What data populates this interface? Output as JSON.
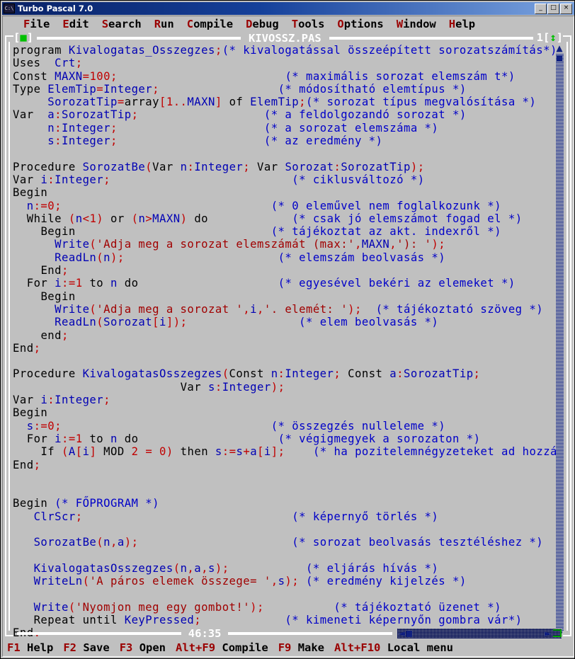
{
  "window": {
    "title": "Turbo Pascal 7.0",
    "icon": "dos-prompt-icon",
    "buttons": {
      "minimize": "_",
      "maximize": "□",
      "close": "×"
    }
  },
  "menubar": {
    "items": [
      {
        "hotkey": "F",
        "rest": "ile"
      },
      {
        "hotkey": "E",
        "rest": "dit"
      },
      {
        "hotkey": "S",
        "rest": "earch"
      },
      {
        "hotkey": "R",
        "rest": "un"
      },
      {
        "hotkey": "C",
        "rest": "ompile"
      },
      {
        "hotkey": "D",
        "rest": "ebug"
      },
      {
        "hotkey": "T",
        "rest": "ools"
      },
      {
        "hotkey": "O",
        "rest": "ptions"
      },
      {
        "hotkey": "W",
        "rest": "indow"
      },
      {
        "hotkey": "H",
        "rest": "elp"
      }
    ]
  },
  "editor": {
    "file_title": "KIVOSSZ.PAS",
    "window_number": "1",
    "close_box": "[■]",
    "zoom_box": "[↕]",
    "cursor_position": "46:35",
    "scrollbar": {
      "up_arrow": "▲",
      "down_arrow": "▼",
      "left_arrow": "◄",
      "right_arrow": "►"
    },
    "lines": [
      [
        [
          "kw",
          "program "
        ],
        [
          "id",
          "Kivalogatas_Osszegzes"
        ],
        [
          "pn",
          ";"
        ],
        [
          "cm",
          "(* kivalogatással összeépített sorozatszámítás*)"
        ]
      ],
      [
        [
          "kw",
          "Uses  "
        ],
        [
          "id",
          "Crt"
        ],
        [
          "pn",
          ";"
        ]
      ],
      [
        [
          "kw",
          "Const "
        ],
        [
          "id",
          "MAXN"
        ],
        [
          "pn",
          "="
        ],
        [
          "num",
          "100"
        ],
        [
          "pn",
          ";"
        ],
        [
          "sp",
          "                        "
        ],
        [
          "cm",
          "(* maximális sorozat elemszám t*)"
        ]
      ],
      [
        [
          "kw",
          "Type "
        ],
        [
          "id",
          "ElemTip"
        ],
        [
          "pn",
          "="
        ],
        [
          "id",
          "Integer"
        ],
        [
          "pn",
          ";"
        ],
        [
          "sp",
          "                 "
        ],
        [
          "cm",
          "(* módosítható elemtípus *)"
        ]
      ],
      [
        [
          "sp",
          "     "
        ],
        [
          "id",
          "SorozatTip"
        ],
        [
          "pn",
          "="
        ],
        [
          "kw",
          "array"
        ],
        [
          "pn",
          "["
        ],
        [
          "num",
          "1"
        ],
        [
          "pn",
          ".."
        ],
        [
          "id",
          "MAXN"
        ],
        [
          "pn",
          "]"
        ],
        [
          "kw",
          " of "
        ],
        [
          "id",
          "ElemTip"
        ],
        [
          "pn",
          ";"
        ],
        [
          "cm",
          "(* sorozat típus megvalósítása *)"
        ]
      ],
      [
        [
          "kw",
          "Var  "
        ],
        [
          "id",
          "a"
        ],
        [
          "pn",
          ":"
        ],
        [
          "id",
          "SorozatTip"
        ],
        [
          "pn",
          ";"
        ],
        [
          "sp",
          "                  "
        ],
        [
          "cm",
          "(* a feldolgozandó sorozat *)"
        ]
      ],
      [
        [
          "sp",
          "     "
        ],
        [
          "id",
          "n"
        ],
        [
          "pn",
          ":"
        ],
        [
          "id",
          "Integer"
        ],
        [
          "pn",
          ";"
        ],
        [
          "sp",
          "                     "
        ],
        [
          "cm",
          "(* a sorozat elemszáma *)"
        ]
      ],
      [
        [
          "sp",
          "     "
        ],
        [
          "id",
          "s"
        ],
        [
          "pn",
          ":"
        ],
        [
          "id",
          "Integer"
        ],
        [
          "pn",
          ";"
        ],
        [
          "sp",
          "                     "
        ],
        [
          "cm",
          "(* az eredmény *)"
        ]
      ],
      [],
      [
        [
          "kw",
          "Procedure "
        ],
        [
          "id",
          "SorozatBe"
        ],
        [
          "pn",
          "("
        ],
        [
          "kw",
          "Var "
        ],
        [
          "id",
          "n"
        ],
        [
          "pn",
          ":"
        ],
        [
          "id",
          "Integer"
        ],
        [
          "pn",
          "; "
        ],
        [
          "kw",
          "Var "
        ],
        [
          "id",
          "Sorozat"
        ],
        [
          "pn",
          ":"
        ],
        [
          "id",
          "SorozatTip"
        ],
        [
          "pn",
          ");"
        ]
      ],
      [
        [
          "kw",
          "Var "
        ],
        [
          "id",
          "i"
        ],
        [
          "pn",
          ":"
        ],
        [
          "id",
          "Integer"
        ],
        [
          "pn",
          ";"
        ],
        [
          "sp",
          "                          "
        ],
        [
          "cm",
          "(* ciklusváltozó *)"
        ]
      ],
      [
        [
          "kw",
          "Begin"
        ]
      ],
      [
        [
          "sp",
          "  "
        ],
        [
          "id",
          "n"
        ],
        [
          "pn",
          ":="
        ],
        [
          "num",
          "0"
        ],
        [
          "pn",
          ";"
        ],
        [
          "sp",
          "                              "
        ],
        [
          "cm",
          "(* 0 eleművel nem foglalkozunk *)"
        ]
      ],
      [
        [
          "sp",
          "  "
        ],
        [
          "kw",
          "While "
        ],
        [
          "pn",
          "("
        ],
        [
          "id",
          "n"
        ],
        [
          "pn",
          "<"
        ],
        [
          "num",
          "1"
        ],
        [
          "pn",
          ") "
        ],
        [
          "kw",
          "or "
        ],
        [
          "pn",
          "("
        ],
        [
          "id",
          "n"
        ],
        [
          "pn",
          ">"
        ],
        [
          "id",
          "MAXN"
        ],
        [
          "pn",
          ") "
        ],
        [
          "kw",
          "do"
        ],
        [
          "sp",
          "            "
        ],
        [
          "cm",
          "(* csak jó elemszámot fogad el *)"
        ]
      ],
      [
        [
          "sp",
          "    "
        ],
        [
          "kw",
          "Begin"
        ],
        [
          "sp",
          "                            "
        ],
        [
          "cm",
          "(* tájékoztat az akt. indexről *)"
        ]
      ],
      [
        [
          "sp",
          "      "
        ],
        [
          "id",
          "Write"
        ],
        [
          "pn",
          "("
        ],
        [
          "st",
          "'Adja meg a sorozat elemszámát (max:'"
        ],
        [
          "pn",
          ","
        ],
        [
          "id",
          "MAXN"
        ],
        [
          "pn",
          ","
        ],
        [
          "st",
          "'): '"
        ],
        [
          "pn",
          ");"
        ]
      ],
      [
        [
          "sp",
          "      "
        ],
        [
          "id",
          "ReadLn"
        ],
        [
          "pn",
          "("
        ],
        [
          "id",
          "n"
        ],
        [
          "pn",
          ");"
        ],
        [
          "sp",
          "                      "
        ],
        [
          "cm",
          "(* elemszám beolvasás *)"
        ]
      ],
      [
        [
          "sp",
          "    "
        ],
        [
          "kw",
          "End"
        ],
        [
          "pn",
          ";"
        ]
      ],
      [
        [
          "sp",
          "  "
        ],
        [
          "kw",
          "For "
        ],
        [
          "id",
          "i"
        ],
        [
          "pn",
          ":="
        ],
        [
          "num",
          "1"
        ],
        [
          "kw",
          " to "
        ],
        [
          "id",
          "n"
        ],
        [
          "kw",
          " do"
        ],
        [
          "sp",
          "                    "
        ],
        [
          "cm",
          "(* egyesével bekéri az elemeket *)"
        ]
      ],
      [
        [
          "sp",
          "    "
        ],
        [
          "kw",
          "Begin"
        ]
      ],
      [
        [
          "sp",
          "      "
        ],
        [
          "id",
          "Write"
        ],
        [
          "pn",
          "("
        ],
        [
          "st",
          "'Adja meg a sorozat '"
        ],
        [
          "pn",
          ","
        ],
        [
          "id",
          "i"
        ],
        [
          "pn",
          ","
        ],
        [
          "st",
          "'. elemét: '"
        ],
        [
          "pn",
          ");"
        ],
        [
          "sp",
          "  "
        ],
        [
          "cm",
          "(* tájékoztató szöveg *)"
        ]
      ],
      [
        [
          "sp",
          "      "
        ],
        [
          "id",
          "ReadLn"
        ],
        [
          "pn",
          "("
        ],
        [
          "id",
          "Sorozat"
        ],
        [
          "pn",
          "["
        ],
        [
          "id",
          "i"
        ],
        [
          "pn",
          "]);"
        ],
        [
          "sp",
          "                "
        ],
        [
          "cm",
          "(* elem beolvasás *)"
        ]
      ],
      [
        [
          "sp",
          "    "
        ],
        [
          "kw",
          "end"
        ],
        [
          "pn",
          ";"
        ]
      ],
      [
        [
          "kw",
          "End"
        ],
        [
          "pn",
          ";"
        ]
      ],
      [],
      [
        [
          "kw",
          "Procedure "
        ],
        [
          "id",
          "KivalogatasOsszegzes"
        ],
        [
          "pn",
          "("
        ],
        [
          "kw",
          "Const "
        ],
        [
          "id",
          "n"
        ],
        [
          "pn",
          ":"
        ],
        [
          "id",
          "Integer"
        ],
        [
          "pn",
          "; "
        ],
        [
          "kw",
          "Const "
        ],
        [
          "id",
          "a"
        ],
        [
          "pn",
          ":"
        ],
        [
          "id",
          "SorozatTip"
        ],
        [
          "pn",
          ";"
        ]
      ],
      [
        [
          "sp",
          "                        "
        ],
        [
          "kw",
          "Var "
        ],
        [
          "id",
          "s"
        ],
        [
          "pn",
          ":"
        ],
        [
          "id",
          "Integer"
        ],
        [
          "pn",
          ");"
        ]
      ],
      [
        [
          "kw",
          "Var "
        ],
        [
          "id",
          "i"
        ],
        [
          "pn",
          ":"
        ],
        [
          "id",
          "Integer"
        ],
        [
          "pn",
          ";"
        ]
      ],
      [
        [
          "kw",
          "Begin"
        ]
      ],
      [
        [
          "sp",
          "  "
        ],
        [
          "id",
          "s"
        ],
        [
          "pn",
          ":="
        ],
        [
          "num",
          "0"
        ],
        [
          "pn",
          ";"
        ],
        [
          "sp",
          "                              "
        ],
        [
          "cm",
          "(* összegzés nulleleme *)"
        ]
      ],
      [
        [
          "sp",
          "  "
        ],
        [
          "kw",
          "For "
        ],
        [
          "id",
          "i"
        ],
        [
          "pn",
          ":="
        ],
        [
          "num",
          "1"
        ],
        [
          "kw",
          " to "
        ],
        [
          "id",
          "n"
        ],
        [
          "kw",
          " do"
        ],
        [
          "sp",
          "                    "
        ],
        [
          "cm",
          "(* végigmegyek a sorozaton *)"
        ]
      ],
      [
        [
          "sp",
          "    "
        ],
        [
          "kw",
          "If "
        ],
        [
          "pn",
          "("
        ],
        [
          "id",
          "A"
        ],
        [
          "pn",
          "["
        ],
        [
          "id",
          "i"
        ],
        [
          "pn",
          "] "
        ],
        [
          "kw",
          "MOD "
        ],
        [
          "num",
          "2"
        ],
        [
          "pn",
          " = "
        ],
        [
          "num",
          "0"
        ],
        [
          "pn",
          ") "
        ],
        [
          "kw",
          "then "
        ],
        [
          "id",
          "s"
        ],
        [
          "pn",
          ":="
        ],
        [
          "id",
          "s"
        ],
        [
          "pn",
          "+"
        ],
        [
          "id",
          "a"
        ],
        [
          "pn",
          "["
        ],
        [
          "id",
          "i"
        ],
        [
          "pn",
          "];"
        ],
        [
          "sp",
          "    "
        ],
        [
          "cm",
          "(* ha pozitelemnégyzeteket ad hozzá"
        ]
      ],
      [
        [
          "kw",
          "End"
        ],
        [
          "pn",
          ";"
        ]
      ],
      [],
      [],
      [
        [
          "kw",
          "Begin "
        ],
        [
          "cm",
          "(* FŐPROGRAM *)"
        ]
      ],
      [
        [
          "sp",
          "   "
        ],
        [
          "id",
          "ClrScr"
        ],
        [
          "pn",
          ";"
        ],
        [
          "sp",
          "                              "
        ],
        [
          "cm",
          "(* képernyő törlés *)"
        ]
      ],
      [],
      [
        [
          "sp",
          "   "
        ],
        [
          "id",
          "SorozatBe"
        ],
        [
          "pn",
          "("
        ],
        [
          "id",
          "n"
        ],
        [
          "pn",
          ","
        ],
        [
          "id",
          "a"
        ],
        [
          "pn",
          ");"
        ],
        [
          "sp",
          "                      "
        ],
        [
          "cm",
          "(* sorozat beolvasás tesztéléshez *)"
        ]
      ],
      [],
      [
        [
          "sp",
          "   "
        ],
        [
          "id",
          "KivalogatasOsszegzes"
        ],
        [
          "pn",
          "("
        ],
        [
          "id",
          "n"
        ],
        [
          "pn",
          ","
        ],
        [
          "id",
          "a"
        ],
        [
          "pn",
          ","
        ],
        [
          "id",
          "s"
        ],
        [
          "pn",
          ");"
        ],
        [
          "sp",
          "           "
        ],
        [
          "cm",
          "(* eljárás hívás *)"
        ]
      ],
      [
        [
          "sp",
          "   "
        ],
        [
          "id",
          "WriteLn"
        ],
        [
          "pn",
          "("
        ],
        [
          "st",
          "'A páros elemek összege= '"
        ],
        [
          "pn",
          ","
        ],
        [
          "id",
          "s"
        ],
        [
          "pn",
          ");"
        ],
        [
          "sp",
          " "
        ],
        [
          "cm",
          "(* eredmény kijelzés *)"
        ]
      ],
      [],
      [
        [
          "sp",
          "   "
        ],
        [
          "id",
          "Write"
        ],
        [
          "pn",
          "("
        ],
        [
          "st",
          "'Nyomjon meg egy gombot!'"
        ],
        [
          "pn",
          ");"
        ],
        [
          "sp",
          "          "
        ],
        [
          "cm",
          "(* tájékoztató üzenet *)"
        ]
      ],
      [
        [
          "sp",
          "   "
        ],
        [
          "kw",
          "Repeat until "
        ],
        [
          "id",
          "KeyPressed"
        ],
        [
          "pn",
          ";"
        ],
        [
          "sp",
          "            "
        ],
        [
          "cm",
          "(* kimeneti képernyőn gombra vár*)"
        ]
      ],
      [
        [
          "kw",
          "End"
        ],
        [
          "pn",
          "."
        ]
      ]
    ]
  },
  "statusbar": {
    "items": [
      {
        "key": "F1",
        "label": " Help"
      },
      {
        "key": "F2",
        "label": " Save"
      },
      {
        "key": "F3",
        "label": " Open"
      },
      {
        "key": "Alt+F9",
        "label": " Compile"
      },
      {
        "key": "F9",
        "label": " Make"
      },
      {
        "key": "Alt+F10",
        "label": " Local menu"
      }
    ]
  },
  "colors": {
    "desktop": "#c0c0c0",
    "titlebar_start": "#0a246a",
    "titlebar_end": "#7aa3e0",
    "keyword": "#000000",
    "identifier": "#0000b4",
    "comment": "#0000c8",
    "number": "#c00000",
    "punctuation": "#c00000",
    "string": "#a00000",
    "frame": "#ffffff",
    "hotkey": "#9a0000",
    "scrollbar": "#102080",
    "boxmarker": "#00c000"
  }
}
